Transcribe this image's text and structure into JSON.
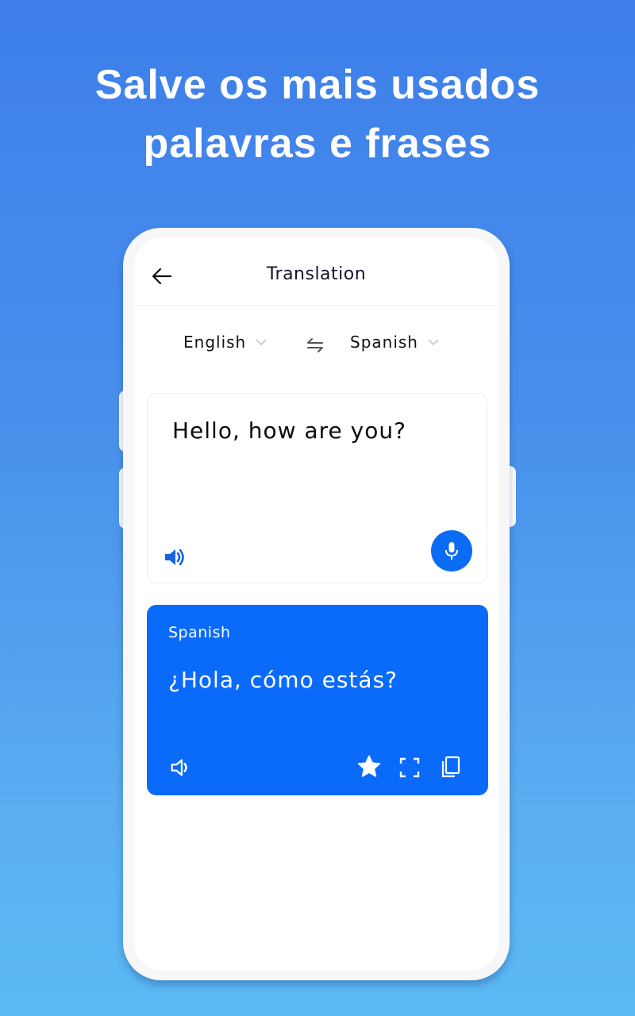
{
  "promo": {
    "headline_line1": "Salve os mais usados",
    "headline_line2": "palavras e frases"
  },
  "app": {
    "title": "Translation",
    "back_icon": "arrow-left-icon",
    "source_language": "English",
    "target_language": "Spanish",
    "swap_icon": "swap-arrows-icon",
    "input": {
      "text": "Hello, how are you?",
      "speaker_icon": "speaker-icon",
      "mic_icon": "microphone-icon"
    },
    "output": {
      "language_label": "Spanish",
      "text": "¿Hola, cómo estás?",
      "actions": [
        "speaker-icon",
        "star-icon",
        "fullscreen-icon",
        "copy-icon"
      ]
    }
  },
  "colors": {
    "background_top": "#3d7eea",
    "background_bottom": "#5cbaf5",
    "accent": "#0a6bfb",
    "text_dark": "#14142b"
  }
}
